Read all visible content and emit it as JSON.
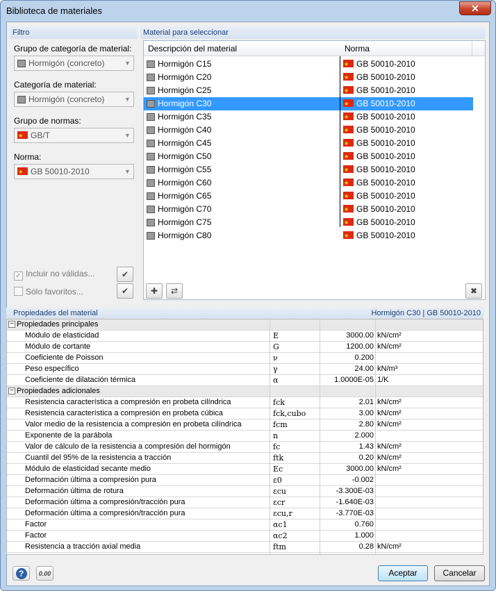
{
  "window": {
    "title": "Biblioteca de materiales",
    "close": "✕"
  },
  "filter": {
    "heading": "Filtro",
    "group_label": "Grupo de categoría de material:",
    "group_value": "Hormigón (concreto)",
    "category_label": "Categoría de material:",
    "category_value": "Hormigón (concreto)",
    "norm_group_label": "Grupo de normas:",
    "norm_group_value": "GB/T",
    "norm_label": "Norma:",
    "norm_value": "GB 50010-2010",
    "include_invalid": "Incluir no válidas...",
    "favorites_only": "Sólo favoritos..."
  },
  "materials": {
    "heading": "Material para seleccionar",
    "col_desc": "Descripción del material",
    "col_norm": "Norma",
    "selected_index": 3,
    "rows": [
      {
        "name": "Hormigón C15",
        "norm": "GB 50010-2010"
      },
      {
        "name": "Hormigón C20",
        "norm": "GB 50010-2010"
      },
      {
        "name": "Hormigón C25",
        "norm": "GB 50010-2010"
      },
      {
        "name": "Hormigón C30",
        "norm": "GB 50010-2010"
      },
      {
        "name": "Hormigón C35",
        "norm": "GB 50010-2010"
      },
      {
        "name": "Hormigón C40",
        "norm": "GB 50010-2010"
      },
      {
        "name": "Hormigón C45",
        "norm": "GB 50010-2010"
      },
      {
        "name": "Hormigón C50",
        "norm": "GB 50010-2010"
      },
      {
        "name": "Hormigón C55",
        "norm": "GB 50010-2010"
      },
      {
        "name": "Hormigón C60",
        "norm": "GB 50010-2010"
      },
      {
        "name": "Hormigón C65",
        "norm": "GB 50010-2010"
      },
      {
        "name": "Hormigón C70",
        "norm": "GB 50010-2010"
      },
      {
        "name": "Hormigón C75",
        "norm": "GB 50010-2010"
      },
      {
        "name": "Hormigón C80",
        "norm": "GB 50010-2010"
      }
    ]
  },
  "properties": {
    "heading": "Propiedades del material",
    "selected_info": "Hormigón C30  |  GB 50010-2010",
    "rows": [
      {
        "section": true,
        "name": "Propiedades principales"
      },
      {
        "name": "Módulo de elasticidad",
        "sym": "E",
        "val": "3000.00",
        "unit": "kN/cm²"
      },
      {
        "name": "Módulo de cortante",
        "sym": "G",
        "val": "1200.00",
        "unit": "kN/cm²"
      },
      {
        "name": "Coeficiente de Poisson",
        "sym": "ν",
        "val": "0.200",
        "unit": ""
      },
      {
        "name": "Peso específico",
        "sym": "γ",
        "val": "24.00",
        "unit": "kN/m³"
      },
      {
        "name": "Coeficiente de dilatación térmica",
        "sym": "α",
        "val": "1.0000E-05",
        "unit": "1/K"
      },
      {
        "section": true,
        "name": "Propiedades adicionales"
      },
      {
        "name": "Resistencia característica a compresión en probeta cilíndrica",
        "sym": "fck",
        "val": "2.01",
        "unit": "kN/cm²"
      },
      {
        "name": "Resistencia característica a compresión en probeta cúbica",
        "sym": "fck,cubo",
        "val": "3.00",
        "unit": "kN/cm²"
      },
      {
        "name": "Valor medio de la resistencia a compresión en probeta cilíndrica",
        "sym": "fcm",
        "val": "2.80",
        "unit": "kN/cm²"
      },
      {
        "name": "Exponente de la parábola",
        "sym": "n",
        "val": "2.000",
        "unit": ""
      },
      {
        "name": "Valor de cálculo de la resistencia a compresión del hormigón",
        "sym": "fc",
        "val": "1.43",
        "unit": "kN/cm²"
      },
      {
        "name": "Cuantil del 95% de la resistencia a tracción",
        "sym": "ftk",
        "val": "0.20",
        "unit": "kN/cm²"
      },
      {
        "name": "Módulo de elasticidad secante medio",
        "sym": "Ec",
        "val": "3000.00",
        "unit": "kN/cm²"
      },
      {
        "name": "Deformación última a compresión pura",
        "sym": "ε0",
        "val": "-0.002",
        "unit": ""
      },
      {
        "name": "Deformación última de rotura",
        "sym": "εcu",
        "val": "-3.300E-03",
        "unit": ""
      },
      {
        "name": "Deformación última a compresión/tracción pura",
        "sym": "εcr",
        "val": "-1.640E-03",
        "unit": ""
      },
      {
        "name": "Deformación última a compresión/tracción pura",
        "sym": "εcu,r",
        "val": "-3.770E-03",
        "unit": ""
      },
      {
        "name": "Factor",
        "sym": "αc1",
        "val": "0.760",
        "unit": ""
      },
      {
        "name": "Factor",
        "sym": "αc2",
        "val": "1.000",
        "unit": ""
      },
      {
        "name": "Resistencia a tracción axial media",
        "sym": "ftm",
        "val": "0.28",
        "unit": "kN/cm²"
      }
    ]
  },
  "footer": {
    "ok": "Aceptar",
    "cancel": "Cancelar",
    "help_icon": "?",
    "units_icon": "0.00"
  },
  "colors": {
    "selection": "#3399ff",
    "heading_text": "#1c3f75",
    "flag": "#de2910"
  }
}
